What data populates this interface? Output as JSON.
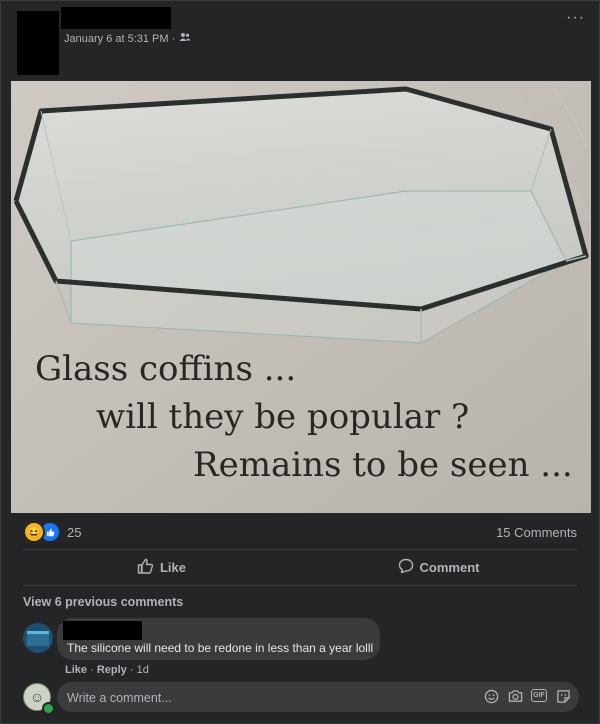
{
  "post": {
    "timestamp": "January 6 at 5:31 PM ·",
    "audience_icon": "friends-icon",
    "more_label": "···"
  },
  "photo": {
    "caption_lines": [
      "Glass coffins ...",
      "will they be popular ?",
      "Remains to be seen ..."
    ]
  },
  "reactions": {
    "types": [
      "haha",
      "like"
    ],
    "count": "25",
    "comments_count": "15 Comments"
  },
  "actions": {
    "like_label": "Like",
    "comment_label": "Comment"
  },
  "comments": {
    "view_previous": "View 6 previous comments",
    "items": [
      {
        "text": "The silicone will need to be redone in less than a year lolll",
        "like": "Like",
        "reply": "Reply",
        "age": "1d"
      }
    ]
  },
  "composer": {
    "placeholder": "Write a comment..."
  },
  "colors": {
    "background": "#242526",
    "bubble": "#3a3b3c",
    "text_secondary": "#b0b3b8",
    "like_blue": "#1877f2",
    "online_green": "#31a24c"
  }
}
